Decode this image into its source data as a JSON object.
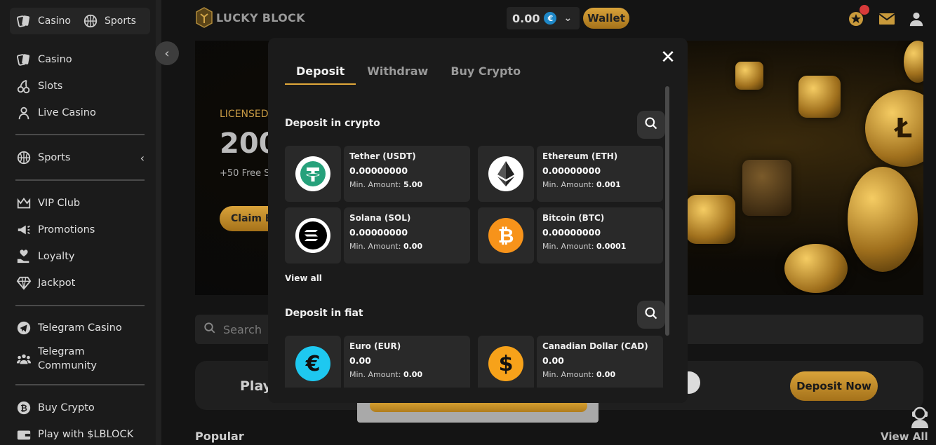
{
  "sidebar": {
    "top_tabs": [
      {
        "label": "Casino",
        "icon": "cards-icon"
      },
      {
        "label": "Sports",
        "icon": "basketball-icon"
      }
    ],
    "items": [
      {
        "label": "Casino",
        "icon": "cards-icon"
      },
      {
        "label": "Slots",
        "icon": "cherries-icon"
      },
      {
        "label": "Live Casino",
        "icon": "dealer-icon"
      },
      {
        "label": "Sports",
        "icon": "basketball-icon"
      },
      {
        "label": "VIP Club",
        "icon": "crown-icon"
      },
      {
        "label": "Promotions",
        "icon": "megaphone-icon"
      },
      {
        "label": "Loyalty",
        "icon": "heart-hand-icon"
      },
      {
        "label": "Jackpot",
        "icon": "diamond-icon"
      },
      {
        "label": "Telegram Casino",
        "icon": "telegram-icon"
      },
      {
        "label": "Telegram Community",
        "icon": "community-icon"
      },
      {
        "label": "Buy Crypto",
        "icon": "bitcoin-icon"
      },
      {
        "label": "Play with $LBLOCK",
        "icon": "wallet-icon"
      }
    ]
  },
  "header": {
    "logo_text": "LUCKY BLOCK",
    "balance": "0.00",
    "currency_symbol": "€",
    "wallet_label": "Wallet"
  },
  "banner": {
    "line1": "LICENSED",
    "line2": "200",
    "line3": "+50 Free S",
    "claim_label": "Claim B"
  },
  "search": {
    "placeholder": "Search"
  },
  "promo": {
    "play_text": "Play",
    "deposit_now_label": "Deposit Now"
  },
  "popular": {
    "title": "Popular",
    "view_all": "View All"
  },
  "modal": {
    "tabs": [
      {
        "label": "Deposit",
        "active": true
      },
      {
        "label": "Withdraw",
        "active": false
      },
      {
        "label": "Buy Crypto",
        "active": false
      }
    ],
    "close_icon": "close-icon",
    "crypto_section_title": "Deposit in crypto",
    "crypto_cards": [
      {
        "name": "Tether (USDT)",
        "balance": "0.00000000",
        "min_label": "Min. Amount:",
        "min_value": "5.00",
        "icon": "tether-icon",
        "color": "#ffffff"
      },
      {
        "name": "Ethereum (ETH)",
        "balance": "0.00000000",
        "min_label": "Min. Amount:",
        "min_value": "0.001",
        "icon": "ethereum-icon",
        "color": "#ffffff"
      },
      {
        "name": "Solana (SOL)",
        "balance": "0.00000000",
        "min_label": "Min. Amount:",
        "min_value": "0.00",
        "icon": "solana-icon",
        "color": "#ffffff"
      },
      {
        "name": "Bitcoin (BTC)",
        "balance": "0.00000000",
        "min_label": "Min. Amount:",
        "min_value": "0.0001",
        "icon": "bitcoin-icon",
        "color": "#f7931a"
      }
    ],
    "view_all": "View all",
    "fiat_section_title": "Deposit in fiat",
    "fiat_cards": [
      {
        "name": "Euro (EUR)",
        "balance": "0.00",
        "min_label": "Min. Amount:",
        "min_value": "0.00",
        "symbol": "€",
        "icon": "euro-icon",
        "color": "#1ec8f0"
      },
      {
        "name": "Canadian Dollar (CAD)",
        "balance": "0.00",
        "min_label": "Min. Amount:",
        "min_value": "0.00",
        "symbol": "$",
        "icon": "dollar-icon",
        "color": "#f7a21a"
      }
    ]
  },
  "colors": {
    "accent_gold": "#d9a33a",
    "tether_green": "#26a17b",
    "euro_blue": "#1ec8f0",
    "btc_orange": "#f7931a"
  }
}
